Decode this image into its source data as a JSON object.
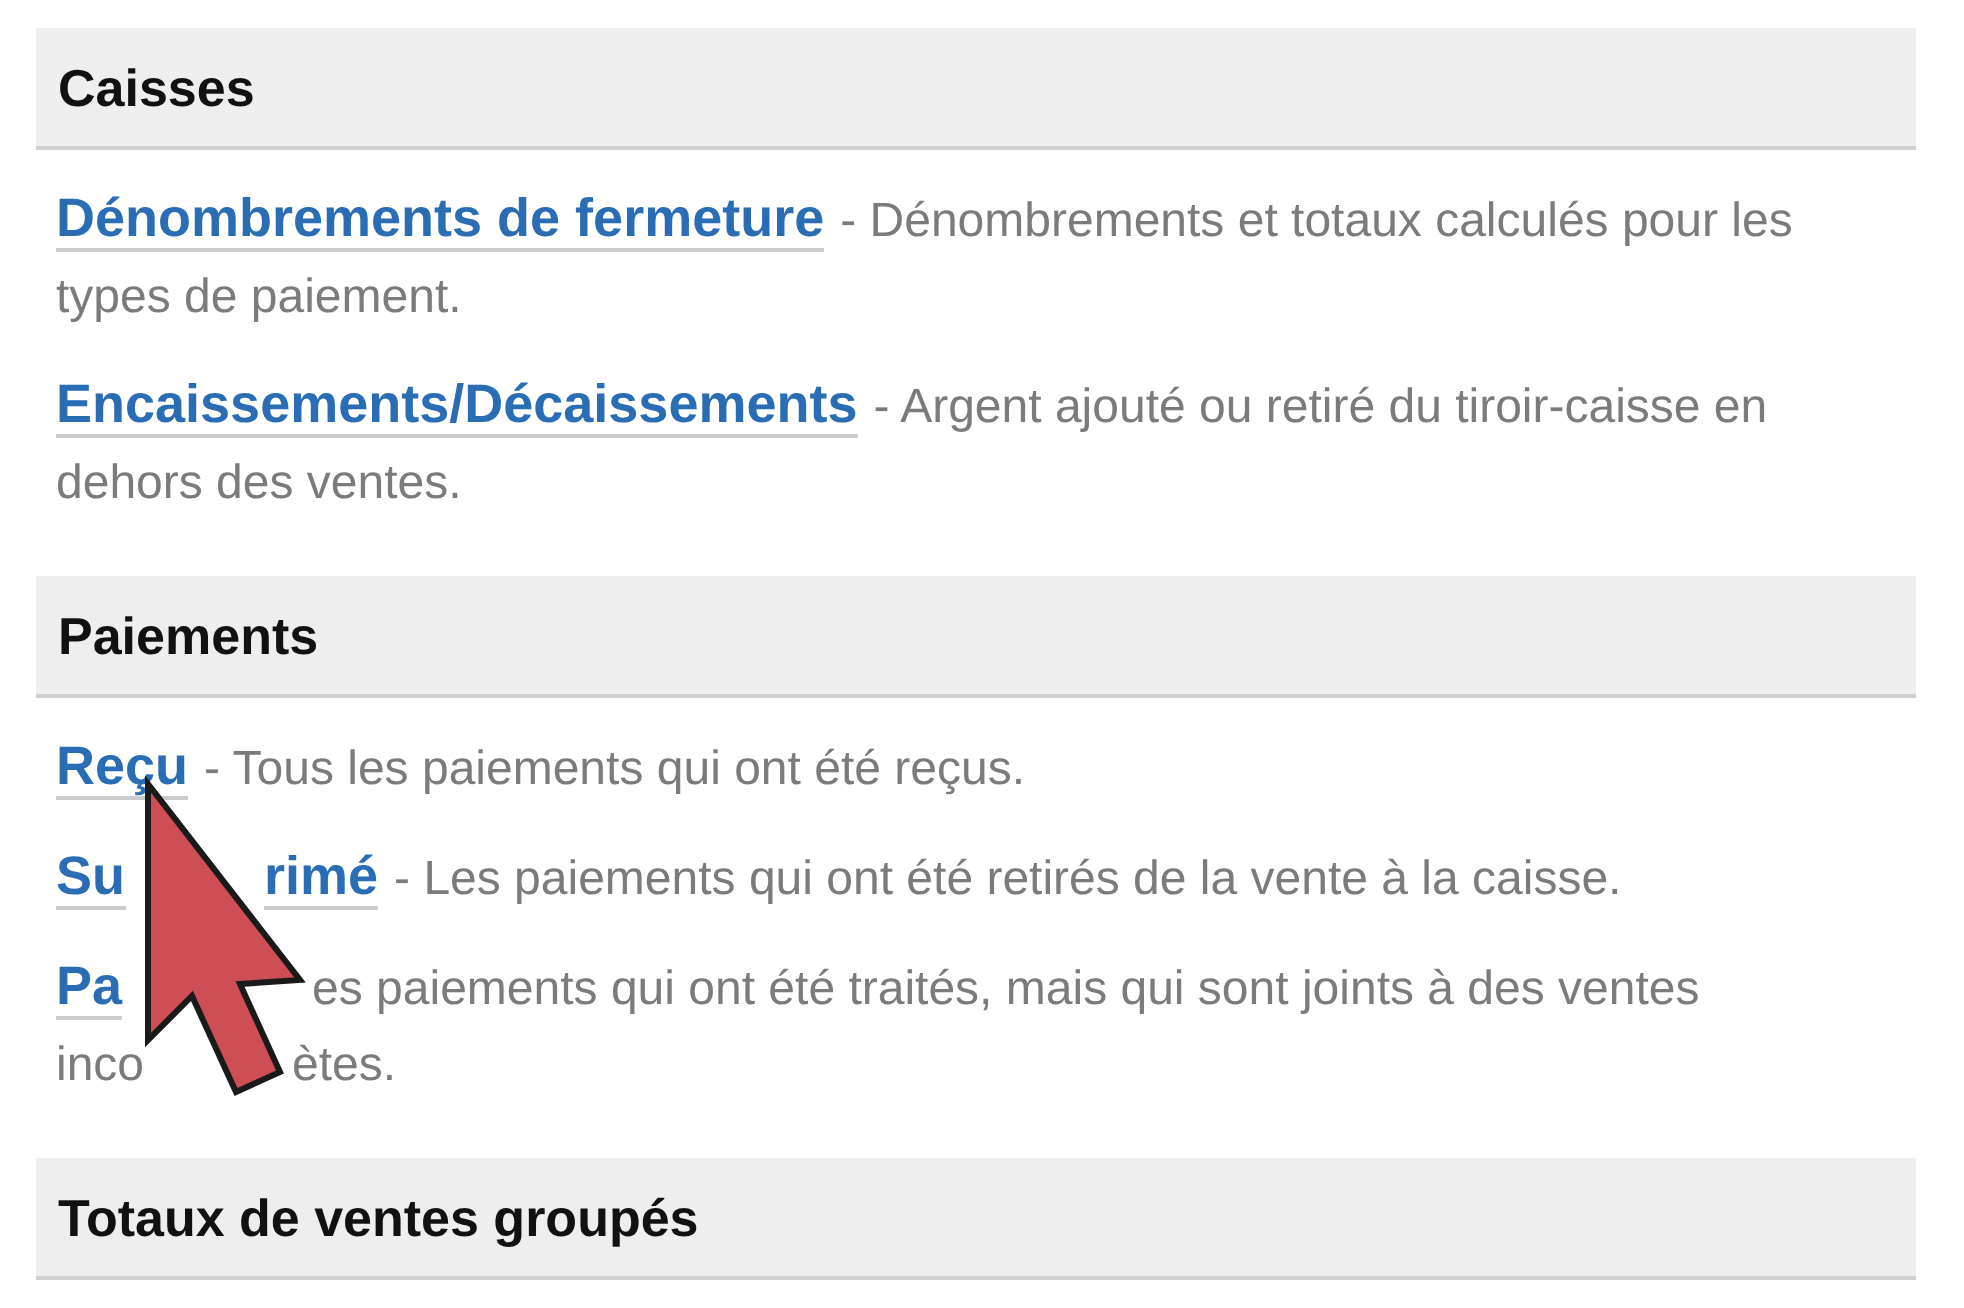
{
  "sections": [
    {
      "title": "Caisses",
      "items": [
        {
          "segments": [
            {
              "kind": "link",
              "text": "Dénombrements de fermeture"
            },
            {
              "kind": "text",
              "text": "- Dénombrements et totaux calculés pour les types de paiement."
            }
          ]
        },
        {
          "segments": [
            {
              "kind": "link",
              "text": "Encaissements/Décaissements"
            },
            {
              "kind": "text",
              "text": "- Argent ajouté ou retiré du tiroir-caisse en dehors des ventes."
            }
          ]
        }
      ]
    },
    {
      "title": "Paiements",
      "items": [
        {
          "segments": [
            {
              "kind": "link",
              "text": "Reçu"
            },
            {
              "kind": "text",
              "text": "- Tous les paiements qui ont été reçus."
            }
          ]
        },
        {
          "segments": [
            {
              "kind": "link",
              "text": "Su"
            },
            {
              "kind": "link",
              "text": "rimé",
              "covered_before": true
            },
            {
              "kind": "text",
              "text": "- Les paiements qui ont été retirés de la vente à la caisse."
            }
          ]
        },
        {
          "segments": [
            {
              "kind": "link",
              "text": "Pa"
            },
            {
              "kind": "text",
              "text": "es paiements qui ont été traités, mais qui sont joints à des ventes",
              "covered_before": true
            },
            {
              "kind": "text",
              "text": "inco",
              "line_break": true
            },
            {
              "kind": "text",
              "text": "ètes.",
              "covered_before": true
            }
          ]
        }
      ]
    },
    {
      "title": "Totaux de ventes groupés"
    }
  ]
}
